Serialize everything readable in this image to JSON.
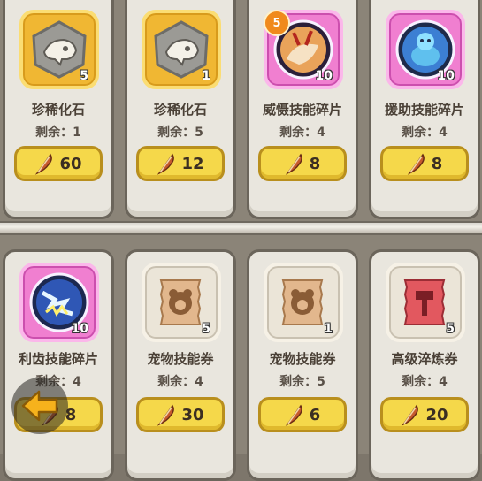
{
  "shop": {
    "items": [
      {
        "name": "珍稀化石",
        "remain": "剩余：1",
        "qty": "5",
        "price": "60"
      },
      {
        "name": "珍稀化石",
        "remain": "剩余：5",
        "qty": "1",
        "price": "12"
      },
      {
        "name": "威慑技能碎片",
        "remain": "剩余：4",
        "qty": "10",
        "level": "5",
        "price": "8"
      },
      {
        "name": "援助技能碎片",
        "remain": "剩余：4",
        "qty": "10",
        "price": "8"
      },
      {
        "name": "利齿技能碎片",
        "remain": "剩余：4",
        "qty": "10",
        "price": "8"
      },
      {
        "name": "宠物技能券",
        "remain": "剩余：4",
        "qty": "5",
        "price": "30"
      },
      {
        "name": "宠物技能券",
        "remain": "剩余：5",
        "qty": "1",
        "price": "6"
      },
      {
        "name": "高级淬炼券",
        "remain": "剩余：4",
        "qty": "5",
        "price": "20"
      }
    ]
  },
  "icons": {
    "currency": "feather-icon",
    "back": "arrow-left-icon"
  },
  "colors": {
    "button_yellow": "#f5d84a",
    "frame_gold": "#f0b733",
    "frame_pink": "#f07fd0"
  }
}
